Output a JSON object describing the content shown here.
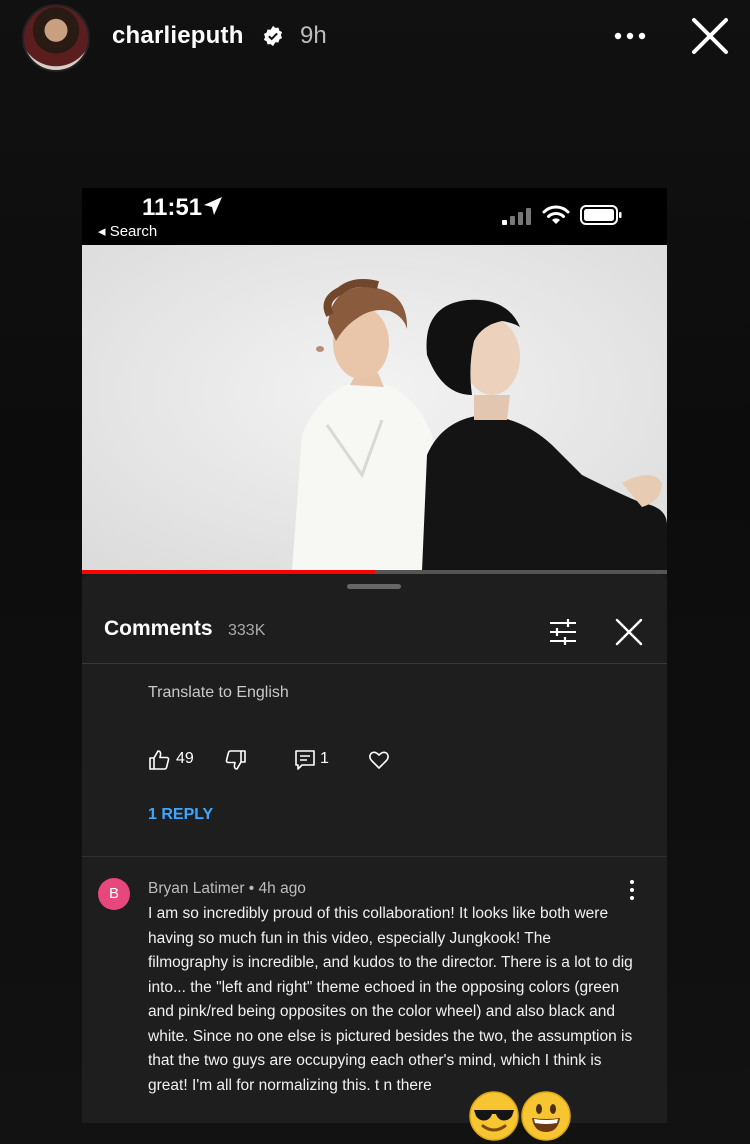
{
  "story": {
    "username": "charlieputh",
    "time": "9h",
    "icons": {
      "verified": "verified-badge-icon",
      "more": "more-horizontal-icon",
      "close": "close-icon"
    }
  },
  "phone": {
    "status": {
      "time": "11:51",
      "back_label": "◂ Search"
    },
    "video": {
      "progress_percent": 50,
      "accent": "#ff0000"
    }
  },
  "comments": {
    "title": "Comments",
    "count": "333K",
    "translate": "Translate to English",
    "likes": "49",
    "replies_count": "1",
    "replies_link": "1 REPLY",
    "comment": {
      "avatar_letter": "B",
      "avatar_color": "#e8477d",
      "author_line": "Bryan Latimer • 4h ago",
      "text": "I am so incredibly proud of this collaboration!  It looks like both were having so much fun in this video, especially Jungkook!  The filmography is incredible, and kudos to the director.  There is a lot to dig into... the \"left and right\" theme echoed in the opposing colors (green and pink/red being opposites on the color wheel) and also black and white.  Since no one else is pictured besides the two, the assumption is that the two guys are occupying each other's mind, which I think is great!  I'm all for normalizing this.        t        n there"
    }
  }
}
